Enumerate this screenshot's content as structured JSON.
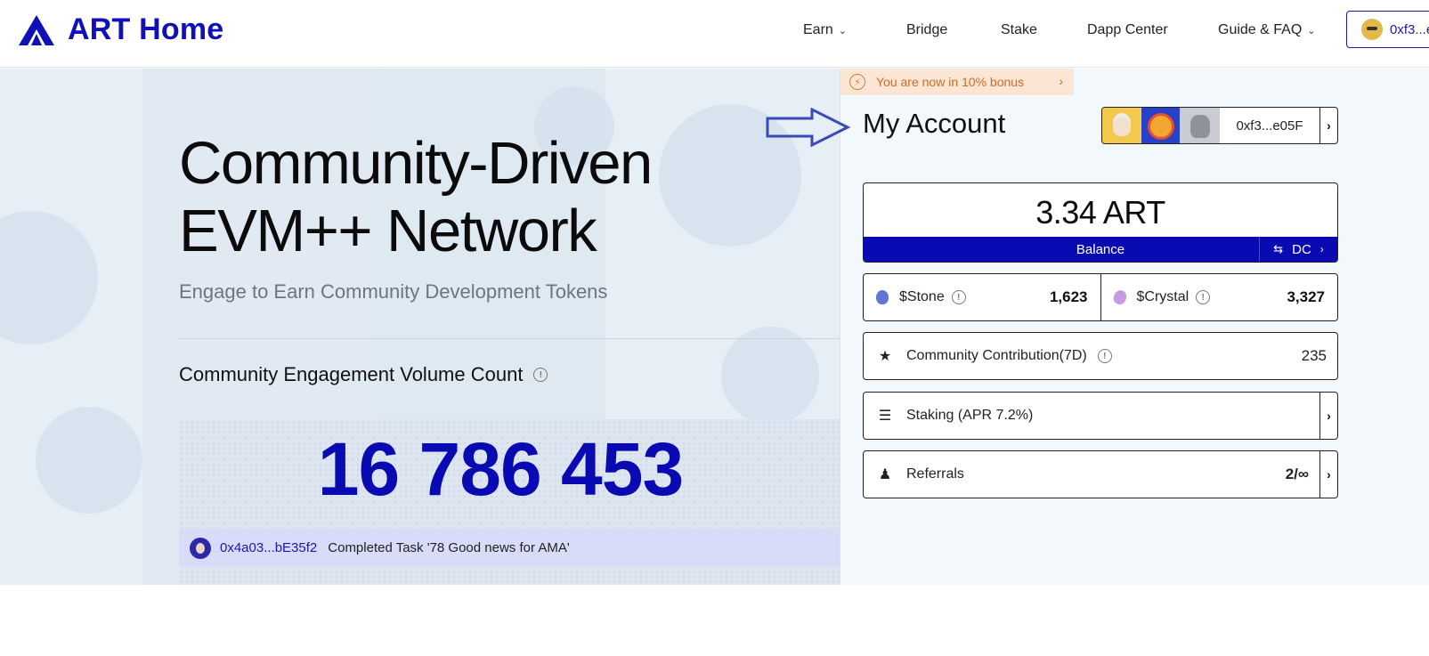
{
  "header": {
    "logo_text": "ART Home",
    "nav": [
      {
        "label": "Earn",
        "has_dropdown": true
      },
      {
        "label": "Bridge",
        "has_dropdown": false
      },
      {
        "label": "Stake",
        "has_dropdown": false
      },
      {
        "label": "Dapp Center",
        "has_dropdown": false
      },
      {
        "label": "Guide & FAQ",
        "has_dropdown": true
      }
    ],
    "wallet_label": "0xf3...e",
    "brand_color": "#1010b8"
  },
  "hero": {
    "title_line1": "Community-Driven",
    "title_line2": "EVM++ Network",
    "subtitle": "Engage to Earn Community Development Tokens",
    "count_label": "Community Engagement Volume Count",
    "count_value": "16 786 453",
    "ticker": {
      "address": "0x4a03...bE35f2",
      "message": "Completed Task '78 Good news for AMA'"
    }
  },
  "account": {
    "bonus_text": "You are now in 10% bonus",
    "title": "My Account",
    "address": "0xf3...e05F",
    "balance": {
      "amount": "3.34 ART",
      "label": "Balance",
      "dc_label": "DC"
    },
    "tokens": [
      {
        "name": "$Stone",
        "value": "1,623",
        "icon": "stone-icon"
      },
      {
        "name": "$Crystal",
        "value": "3,327",
        "icon": "crystal-icon"
      }
    ],
    "contribution": {
      "label": "Community Contribution(7D)",
      "value": "235"
    },
    "staking": {
      "label": "Staking (APR 7.2%)"
    },
    "referrals": {
      "label": "Referrals",
      "value": "2/∞"
    }
  }
}
